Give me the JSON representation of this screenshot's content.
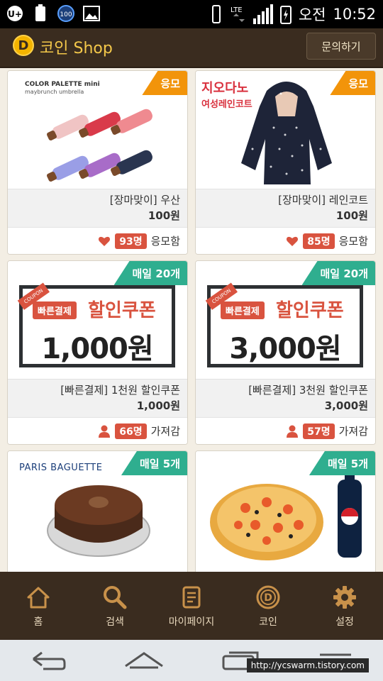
{
  "status": {
    "time": "10:52",
    "ampm": "오전",
    "battery_label": "100",
    "lte": "LTE",
    "u_plus": "U+"
  },
  "header": {
    "title": "코인 Shop",
    "coin_letter": "D",
    "inquiry_button": "문의하기"
  },
  "products": [
    {
      "ribbon": "응모",
      "ribbon_color": "#f2940a",
      "name": "[장마맞이] 우산",
      "price": "100원",
      "count": "93명",
      "count_suffix": "응모함",
      "icon": "heart-icon",
      "image_caption_1": "COLOR PALETTE mini",
      "image_caption_2": "maybrunch umbrella"
    },
    {
      "ribbon": "응모",
      "ribbon_color": "#f2940a",
      "name": "[장마맞이] 레인코트",
      "price": "100원",
      "count": "85명",
      "count_suffix": "응모함",
      "icon": "heart-icon",
      "image_caption_1": "지오다노",
      "image_caption_2": "여성레인코트"
    },
    {
      "ribbon": "매일 20개",
      "ribbon_color": "#2fae8f",
      "name": "[빠른결제] 1천원 할인쿠폰",
      "price": "1,000원",
      "count": "66명",
      "count_suffix": "가져감",
      "icon": "person-icon",
      "coupon_tag": "COUPON",
      "coupon_quick": "빠른결제",
      "coupon_title": "할인쿠폰",
      "coupon_amount": "1,000원"
    },
    {
      "ribbon": "매일 20개",
      "ribbon_color": "#2fae8f",
      "name": "[빠른결제] 3천원 할인쿠폰",
      "price": "3,000원",
      "count": "57명",
      "count_suffix": "가져감",
      "icon": "person-icon",
      "coupon_tag": "COUPON",
      "coupon_quick": "빠른결제",
      "coupon_title": "할인쿠폰",
      "coupon_amount": "3,000원"
    },
    {
      "ribbon": "매일 5개",
      "ribbon_color": "#2fae8f",
      "image_caption_1": "PARIS BAGUETTE"
    },
    {
      "ribbon": "매일 5개",
      "ribbon_color": "#2fae8f"
    }
  ],
  "nav": [
    {
      "label": "홈",
      "icon": "home-icon"
    },
    {
      "label": "검색",
      "icon": "search-icon"
    },
    {
      "label": "마이페이지",
      "icon": "document-icon"
    },
    {
      "label": "코인",
      "icon": "coin-icon"
    },
    {
      "label": "설정",
      "icon": "gear-icon"
    }
  ],
  "watermark": "http://ycswarm.tistory.com"
}
